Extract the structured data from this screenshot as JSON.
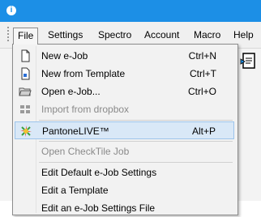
{
  "titlebar": {
    "app_icon_glyph": "i",
    "accent": "#1c8fe6"
  },
  "menubar": {
    "items": [
      {
        "label": "File"
      },
      {
        "label": "Settings"
      },
      {
        "label": "Spectro"
      },
      {
        "label": "Account"
      },
      {
        "label": "Macro"
      },
      {
        "label": "Help"
      }
    ]
  },
  "file_menu": {
    "items": [
      {
        "label": "New e-Job",
        "shortcut": "Ctrl+N",
        "icon": "new-job-icon",
        "enabled": true
      },
      {
        "label": "New from Template",
        "shortcut": "Ctrl+T",
        "icon": "new-template-icon",
        "enabled": true
      },
      {
        "label": "Open e-Job...",
        "shortcut": "Ctrl+O",
        "icon": "open-job-icon",
        "enabled": true
      },
      {
        "label": "Import from dropbox",
        "shortcut": "",
        "icon": "dropbox-icon",
        "enabled": false
      },
      {
        "label": "PantoneLIVE™",
        "shortcut": "Alt+P",
        "icon": "pantonelive-icon",
        "enabled": true,
        "highlighted": true
      },
      {
        "label": "Open CheckTile Job",
        "shortcut": "",
        "icon": "",
        "enabled": false
      },
      {
        "label": "Edit Default e-Job Settings",
        "shortcut": "",
        "icon": "",
        "enabled": true
      },
      {
        "label": "Edit a Template",
        "shortcut": "",
        "icon": "",
        "enabled": true
      },
      {
        "label": "Edit an e-Job Settings File",
        "shortcut": "",
        "icon": "",
        "enabled": true
      }
    ]
  },
  "colors": {
    "highlight_bg": "#d9e8f7",
    "highlight_border": "#9cc4eb",
    "disabled_text": "#8a8a8a"
  }
}
